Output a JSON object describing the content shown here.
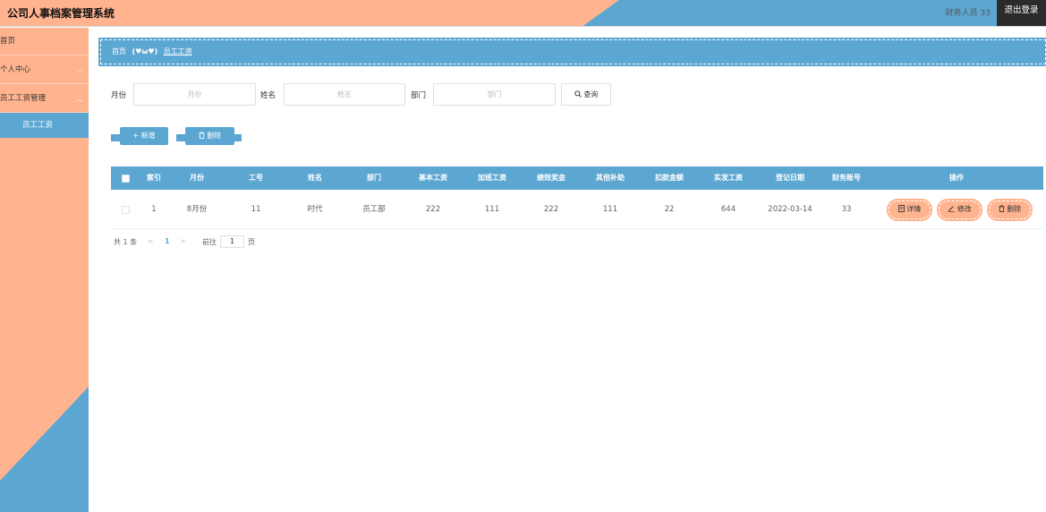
{
  "app": {
    "title": "公司人事档案管理系统",
    "user": "财务人员 33",
    "logout": "退出登录"
  },
  "sidebar": {
    "items": [
      {
        "label": "首页"
      },
      {
        "label": "个人中心",
        "chevron": "chevron-down-icon"
      },
      {
        "label": "员工工资管理",
        "chevron": "chevron-up-icon"
      }
    ],
    "sub_item": "员工工资"
  },
  "breadcrumb": {
    "home": "首页",
    "separator": "(♥ω♥)",
    "current": "员工工资"
  },
  "search": {
    "fields": [
      {
        "label": "月份",
        "placeholder": "月份"
      },
      {
        "label": "姓名",
        "placeholder": "姓名"
      },
      {
        "label": "部门",
        "placeholder": "部门"
      }
    ],
    "button": "查询",
    "button_icon": "search-icon"
  },
  "actions": {
    "add": "+ 新增",
    "delete": "删除",
    "delete_icon": "trash-icon"
  },
  "table": {
    "columns": [
      "索引",
      "月份",
      "工号",
      "姓名",
      "部门",
      "基本工资",
      "加班工资",
      "绩效奖金",
      "其他补助",
      "扣款金额",
      "实发工资",
      "登记日期",
      "财务账号",
      "操作"
    ],
    "rows": [
      {
        "cells": [
          "1",
          "8月份",
          "11",
          "时代",
          "员工部",
          "222",
          "111",
          "222",
          "111",
          "22",
          "644",
          "2022-03-14",
          "33"
        ]
      }
    ],
    "row_actions": {
      "detail": "详情",
      "edit": "修改",
      "delete": "删除"
    }
  },
  "pagination": {
    "total": "共 1 条",
    "prev": "<",
    "page": "1",
    "next": ">",
    "goto_label": "前往",
    "goto_value": "1",
    "page_suffix": "页"
  },
  "colors": {
    "peach": "#ffb48f",
    "blue": "#5ba7d2",
    "dark": "#2b2b2b"
  }
}
